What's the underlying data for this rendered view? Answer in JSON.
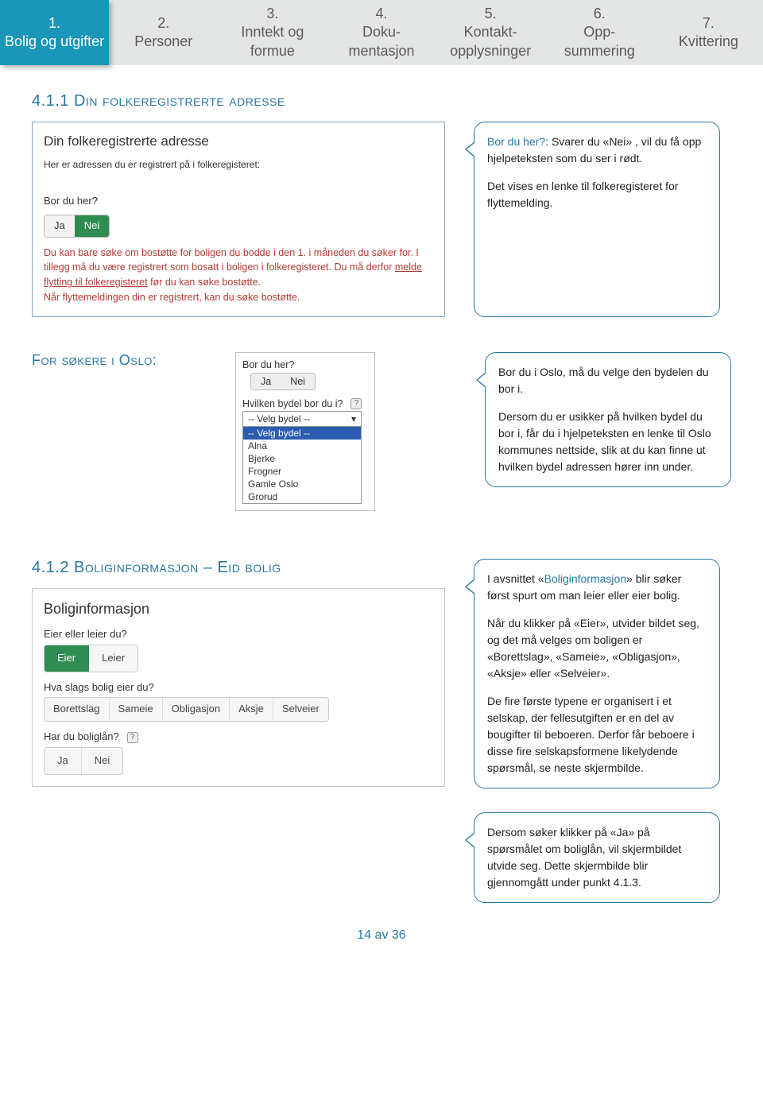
{
  "steps": [
    {
      "num": "1.",
      "label": "Bolig og utgifter",
      "active": true
    },
    {
      "num": "2.",
      "label": "Personer"
    },
    {
      "num": "3.",
      "label": "Inntekt og formue"
    },
    {
      "num": "4.",
      "label": "Doku-\nmentasjon"
    },
    {
      "num": "5.",
      "label": "Kontakt-\nopplysninger"
    },
    {
      "num": "6.",
      "label": "Opp-\nsummering"
    },
    {
      "num": "7.",
      "label": "Kvittering"
    }
  ],
  "section411": {
    "heading": "4.1.1 Din folkeregistrerte adresse",
    "shot": {
      "title": "Din folkeregistrerte adresse",
      "sub": "Her er adressen du er registrert på i folkeregisteret:",
      "q": "Bor du her?",
      "ja": "Ja",
      "nei": "Nei",
      "warn_a": "Du kan bare søke om bostøtte for boligen du bodde i den 1. i måneden du søker for. I tillegg må du være registrert som bosatt i boligen i folkeregisteret. Du må derfor ",
      "warn_link": "melde flytting til folkeregisteret",
      "warn_b": " før du kan søke bostøtte.\nNår flyttemeldingen din er registrert, kan du søke bostøtte."
    },
    "callout": {
      "p1_lead": "Bor du her?",
      "p1_rest": ": Svarer du «Nei» , vil du få opp hjelpeteksten som du ser i rødt.",
      "p2": "Det vises en lenke til folkeregisteret for flyttemelding."
    }
  },
  "oslo": {
    "heading": "For søkere i Oslo:",
    "shot": {
      "q1": "Bor du her?",
      "ja": "Ja",
      "nei": "Nei",
      "q2": "Hvilken bydel bor du i?",
      "sel_label": "-- Velg bydel --",
      "sel_first": "-- Velg bydel --",
      "opts": [
        "Alna",
        "Bjerke",
        "Frogner",
        "Gamle Oslo",
        "Grorud"
      ]
    },
    "callout": {
      "p1": "Bor du i Oslo, må du velge den bydelen du bor i.",
      "p2": "Dersom du er usikker på hvilken bydel du bor i, får du i hjelpeteksten en lenke til Oslo kommunes nettside, slik at du kan finne ut hvilken bydel adressen hører inn under."
    }
  },
  "section412": {
    "heading": "4.1.2 Boliginformasjon – Eid bolig",
    "shot": {
      "title": "Boliginformasjon",
      "q1": "Eier eller leier du?",
      "eier": "Eier",
      "leier": "Leier",
      "q2": "Hva slags bolig eier du?",
      "opts": [
        "Borettslag",
        "Sameie",
        "Obligasjon",
        "Aksje",
        "Selveier"
      ],
      "q3": "Har du boliglån?",
      "ja": "Ja",
      "nei": "Nei"
    },
    "callout": {
      "p1_a": "I avsnittet «",
      "p1_blue": "Boliginformasjon",
      "p1_b": "» blir søker først spurt om man leier eller eier bolig.",
      "p2": "Når du klikker på «Eier», utvider bildet seg, og det må velges om boligen er «Borettslag», «Sameie», «Obligasjon», «Aksje» eller «Selveier».",
      "p3": "De fire første typene er organisert i et selskap, der fellesutgiften er en del av bougifter til beboeren. Derfor får beboere i disse fire selskapsformene likelydende spørsmål, se neste skjermbilde.",
      "p4": "Dersom søker klikker på «Ja» på spørsmålet om boliglån, vil skjermbildet  utvide seg. Dette skjermbilde blir gjennomgått under punkt 4.1.3."
    }
  },
  "page": "14 av 36"
}
